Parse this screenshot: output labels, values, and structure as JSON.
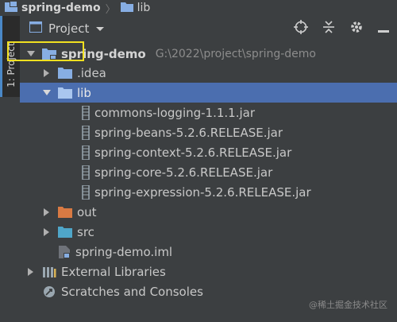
{
  "breadcrumb": {
    "project": "spring-demo",
    "folder": "lib"
  },
  "side_tab": {
    "label": "1: Project"
  },
  "panel": {
    "title": "Project"
  },
  "tree": {
    "root": {
      "name": "spring-demo",
      "path": "G:\\2022\\project\\spring-demo"
    },
    "idea": ".idea",
    "lib": "lib",
    "jars": [
      "commons-logging-1.1.1.jar",
      "spring-beans-5.2.6.RELEASE.jar",
      "spring-context-5.2.6.RELEASE.jar",
      "spring-core-5.2.6.RELEASE.jar",
      "spring-expression-5.2.6.RELEASE.jar"
    ],
    "out": "out",
    "src": "src",
    "iml": "spring-demo.iml",
    "external_libraries": "External Libraries",
    "scratches": "Scratches and Consoles"
  },
  "watermark": "@稀土掘金技术社区",
  "colors": {
    "selection": "#4b6eaf",
    "folder_blue": "#87aee3",
    "folder_orange": "#d97a43",
    "folder_teal": "#4fa6c9",
    "highlight": "#f0e020"
  }
}
